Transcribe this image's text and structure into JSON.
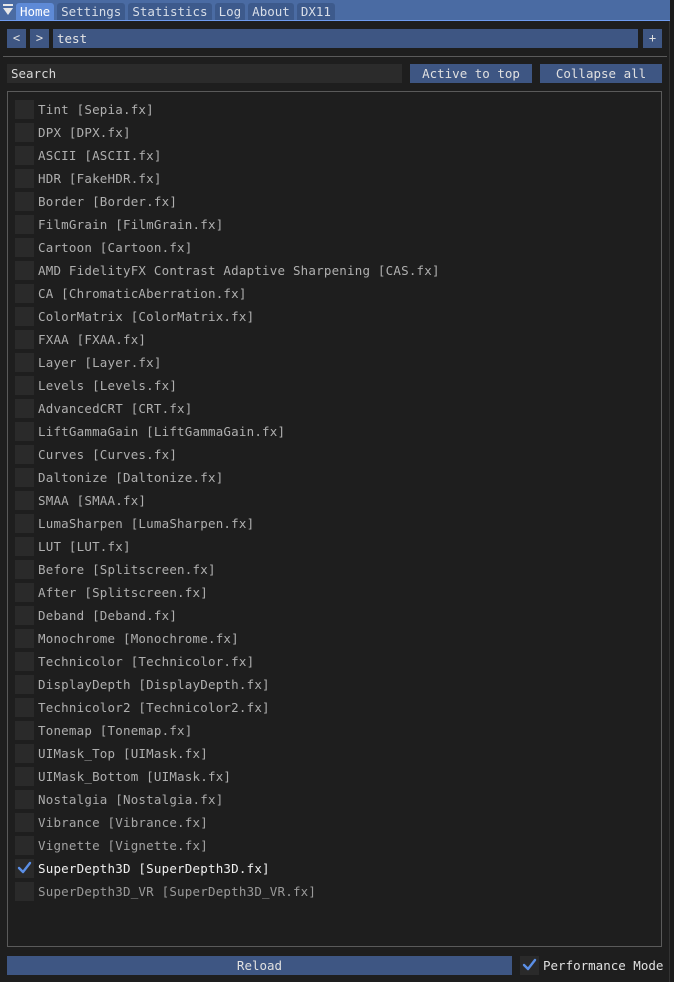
{
  "tabs": [
    {
      "label": "Home",
      "active": true
    },
    {
      "label": "Settings",
      "active": false
    },
    {
      "label": "Statistics",
      "active": false
    },
    {
      "label": "Log",
      "active": false
    },
    {
      "label": "About",
      "active": false
    },
    {
      "label": "DX11",
      "active": false
    }
  ],
  "nav": {
    "prev_label": "<",
    "next_label": ">",
    "preset_value": "test",
    "add_label": "+"
  },
  "search": {
    "placeholder": "Search",
    "value": ""
  },
  "buttons": {
    "active_to_top": "Active to top",
    "collapse_all": "Collapse all",
    "reload": "Reload"
  },
  "performance_mode": {
    "label": "Performance Mode",
    "checked": true
  },
  "colors": {
    "accent": "#5e8ad6",
    "checkmark": "#5b8fe6",
    "button": "#3e5683",
    "text": "#d6d6d6"
  },
  "effects": [
    {
      "label": "Tint [Sepia.fx]",
      "checked": false
    },
    {
      "label": "DPX [DPX.fx]",
      "checked": false
    },
    {
      "label": "ASCII [ASCII.fx]",
      "checked": false
    },
    {
      "label": "HDR [FakeHDR.fx]",
      "checked": false
    },
    {
      "label": "Border [Border.fx]",
      "checked": false
    },
    {
      "label": "FilmGrain [FilmGrain.fx]",
      "checked": false
    },
    {
      "label": "Cartoon [Cartoon.fx]",
      "checked": false
    },
    {
      "label": "AMD FidelityFX Contrast Adaptive Sharpening [CAS.fx]",
      "checked": false
    },
    {
      "label": "CA [ChromaticAberration.fx]",
      "checked": false
    },
    {
      "label": "ColorMatrix [ColorMatrix.fx]",
      "checked": false
    },
    {
      "label": "FXAA [FXAA.fx]",
      "checked": false
    },
    {
      "label": "Layer [Layer.fx]",
      "checked": false
    },
    {
      "label": "Levels [Levels.fx]",
      "checked": false
    },
    {
      "label": "AdvancedCRT [CRT.fx]",
      "checked": false
    },
    {
      "label": "LiftGammaGain [LiftGammaGain.fx]",
      "checked": false
    },
    {
      "label": "Curves [Curves.fx]",
      "checked": false
    },
    {
      "label": "Daltonize [Daltonize.fx]",
      "checked": false
    },
    {
      "label": "SMAA [SMAA.fx]",
      "checked": false
    },
    {
      "label": "LumaSharpen [LumaSharpen.fx]",
      "checked": false
    },
    {
      "label": "LUT [LUT.fx]",
      "checked": false
    },
    {
      "label": "Before [Splitscreen.fx]",
      "checked": false
    },
    {
      "label": "After [Splitscreen.fx]",
      "checked": false
    },
    {
      "label": "Deband [Deband.fx]",
      "checked": false
    },
    {
      "label": "Monochrome [Monochrome.fx]",
      "checked": false
    },
    {
      "label": "Technicolor [Technicolor.fx]",
      "checked": false
    },
    {
      "label": "DisplayDepth [DisplayDepth.fx]",
      "checked": false
    },
    {
      "label": "Technicolor2 [Technicolor2.fx]",
      "checked": false
    },
    {
      "label": "Tonemap [Tonemap.fx]",
      "checked": false
    },
    {
      "label": "UIMask_Top [UIMask.fx]",
      "checked": false
    },
    {
      "label": "UIMask_Bottom [UIMask.fx]",
      "checked": false
    },
    {
      "label": "Nostalgia [Nostalgia.fx]",
      "checked": false
    },
    {
      "label": "Vibrance [Vibrance.fx]",
      "checked": false
    },
    {
      "label": "Vignette [Vignette.fx]",
      "checked": false
    },
    {
      "label": "SuperDepth3D [SuperDepth3D.fx]",
      "checked": true
    },
    {
      "label": "SuperDepth3D_VR [SuperDepth3D_VR.fx]",
      "checked": false
    }
  ]
}
